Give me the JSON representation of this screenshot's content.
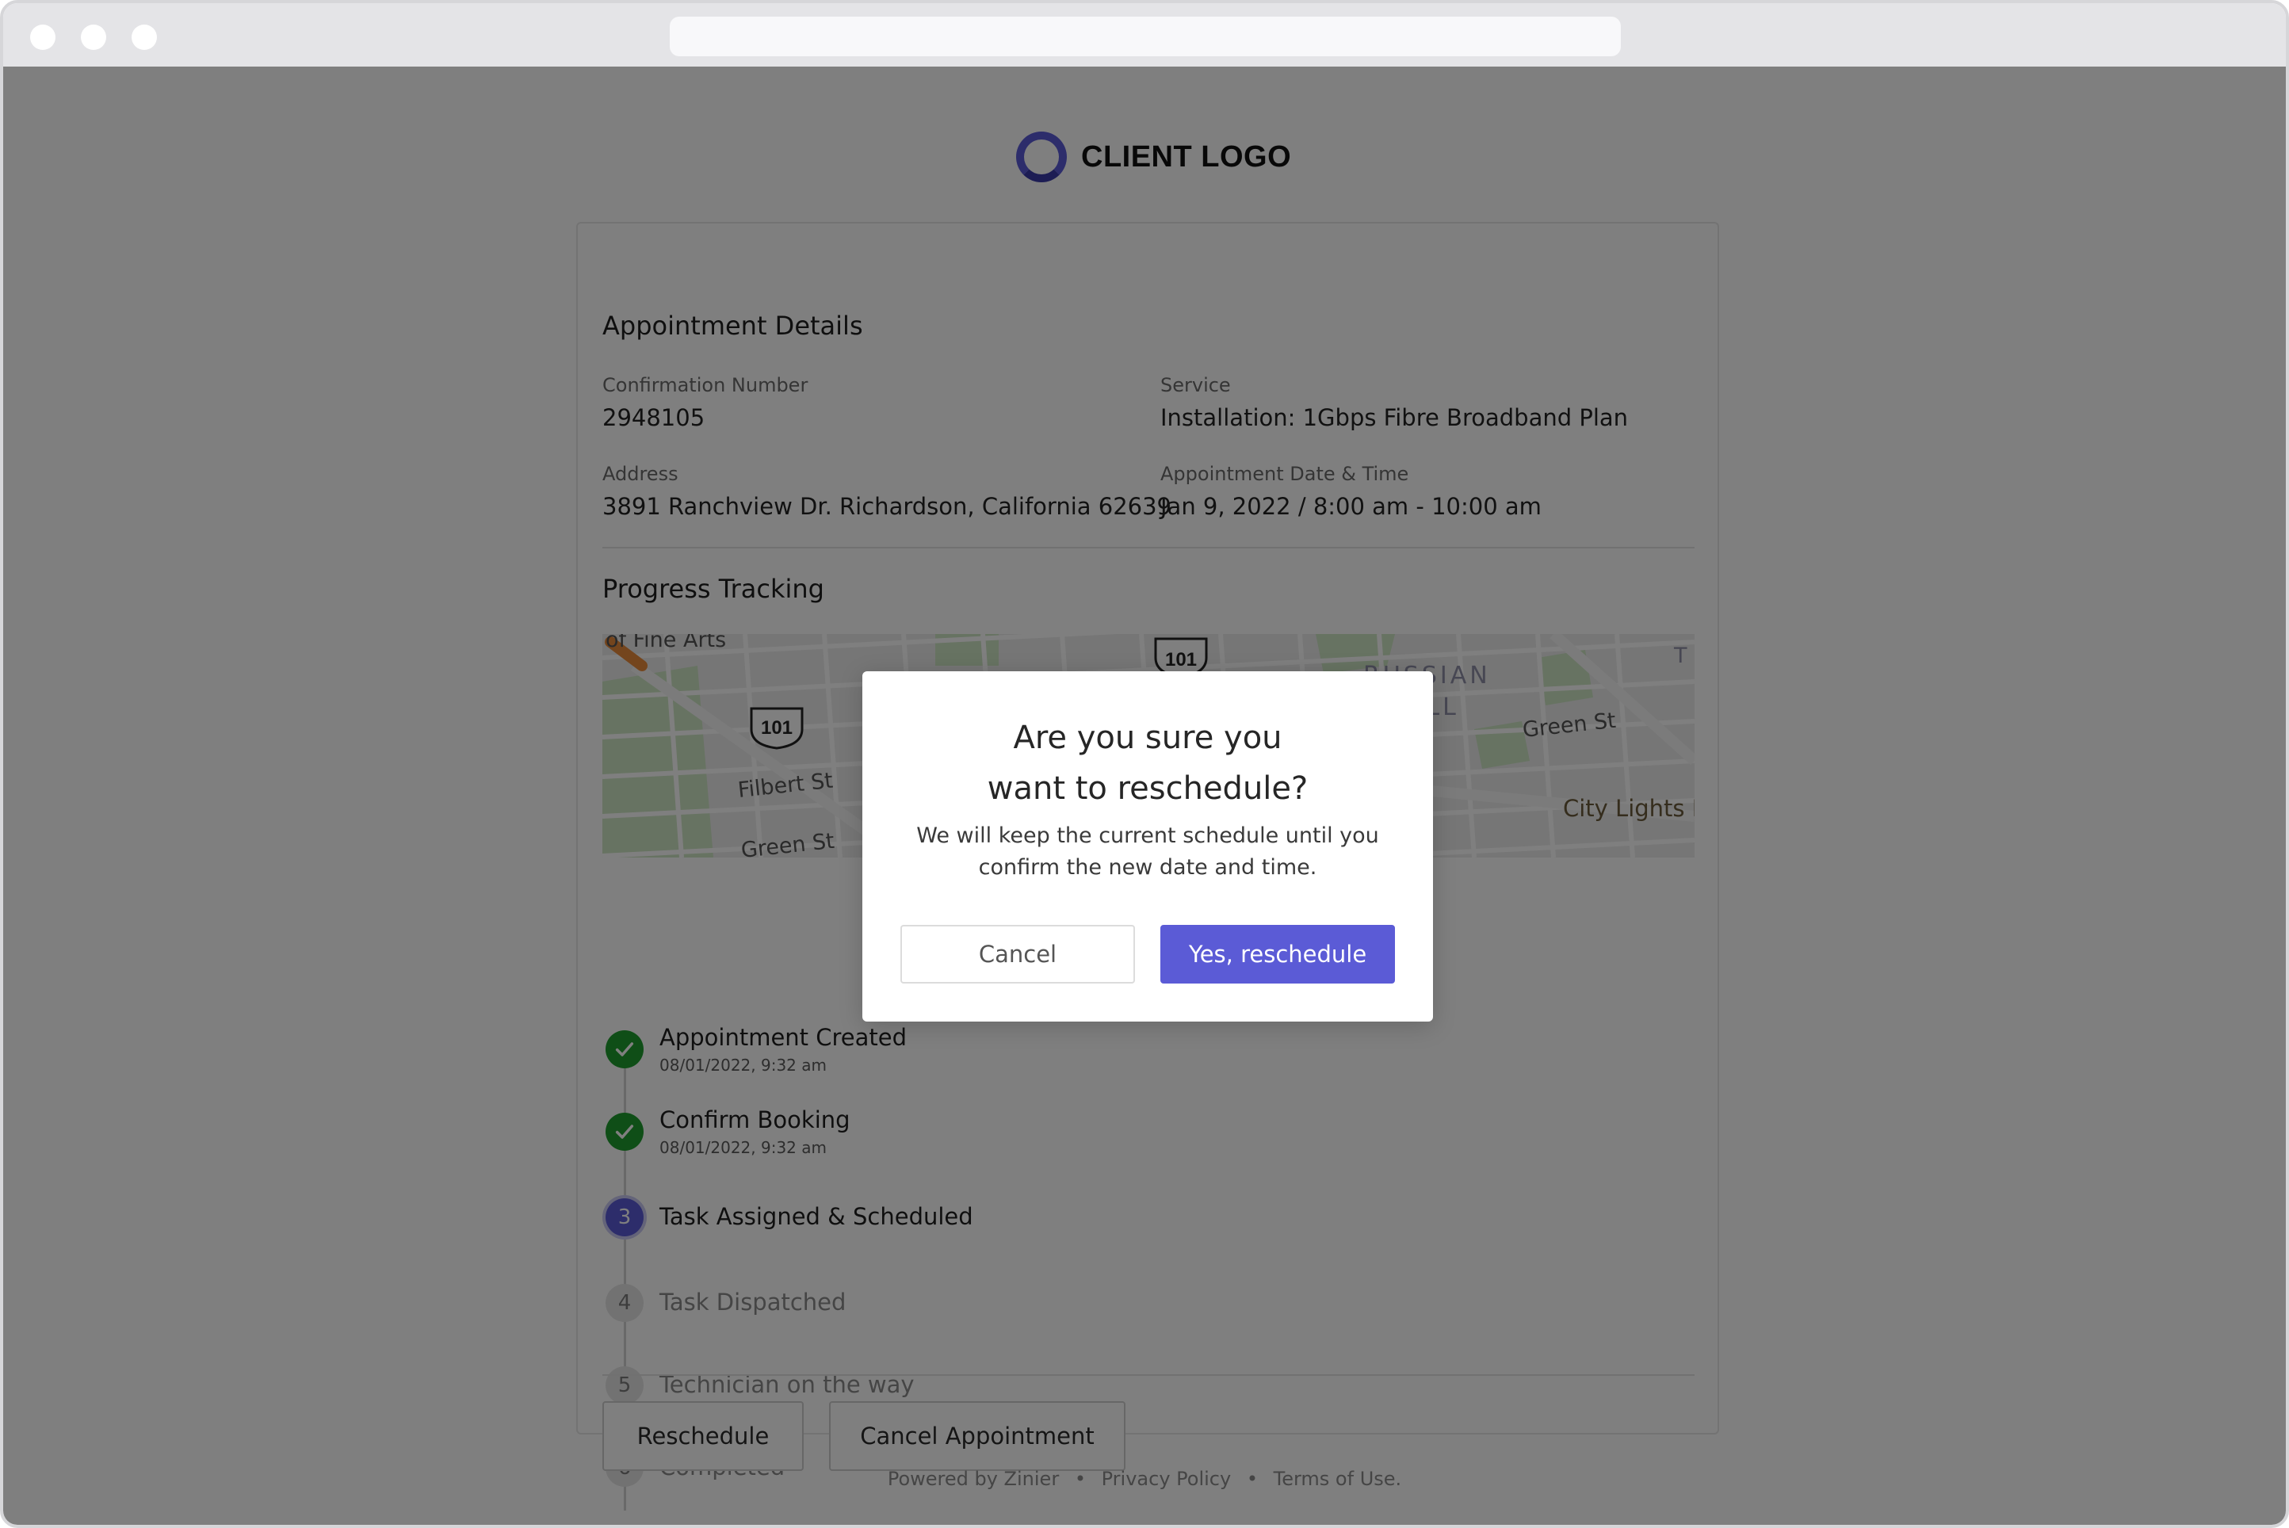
{
  "brand": {
    "logo_text": "CLIENT LOGO",
    "accent": "#5b5bd6",
    "success": "#1f9d2e"
  },
  "details": {
    "title": "Appointment Details",
    "confirmation_label": "Confirmation Number",
    "confirmation_value": "2948105",
    "service_label": "Service",
    "service_value": "Installation: 1Gbps Fibre Broadband Plan",
    "address_label": "Address",
    "address_value": "3891 Ranchview Dr. Richardson, California 62639",
    "datetime_label": "Appointment Date & Time",
    "datetime_value": "Jan 9, 2022 / 8:00 am - 10:00 am"
  },
  "progress": {
    "title": "Progress Tracking",
    "map_labels": {
      "fine_arts": "of Fine Arts",
      "filbert": "Filbert St",
      "green1": "Green St",
      "green2": "Green St",
      "russian": "RUSSIAN",
      "hill": "HILL",
      "city_lights": "City Lights B",
      "t": "T",
      "hwy1": "101",
      "hwy2": "101"
    },
    "steps": [
      {
        "title": "Appointment Created",
        "time": "08/01/2022, 9:32 am",
        "status": "done"
      },
      {
        "title": "Confirm Booking",
        "time": "08/01/2022, 9:32 am",
        "status": "done"
      },
      {
        "number": "3",
        "title": "Task Assigned & Scheduled",
        "status": "current"
      },
      {
        "number": "4",
        "title": "Task Dispatched",
        "status": "pending"
      },
      {
        "number": "5",
        "title": "Technician on the way",
        "status": "pending"
      },
      {
        "number": "6",
        "title": "Completed",
        "status": "pending"
      }
    ]
  },
  "actions": {
    "reschedule": "Reschedule",
    "cancel_appointment": "Cancel Appointment"
  },
  "footer": {
    "powered": "Powered by Zinier",
    "sep": "•",
    "privacy": "Privacy Policy",
    "terms": "Terms of Use."
  },
  "modal": {
    "title_line1": "Are you sure you",
    "title_line2": "want to reschedule?",
    "message": "We will keep the current schedule until you confirm the new date and time.",
    "cancel": "Cancel",
    "confirm": "Yes, reschedule"
  }
}
